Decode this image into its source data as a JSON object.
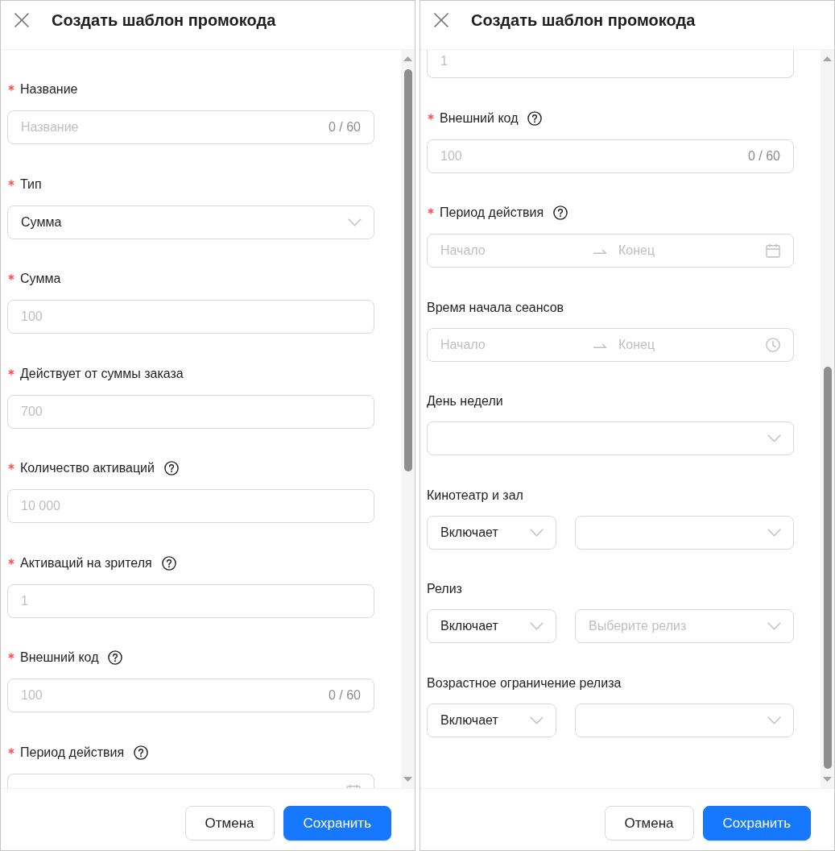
{
  "panels": [
    {
      "title": "Создать шаблон промокода",
      "scrolled": false,
      "fields": [
        {
          "kind": "text",
          "label": "Название",
          "required": true,
          "help": false,
          "placeholder": "Название",
          "counter": "0 / 60"
        },
        {
          "kind": "select",
          "label": "Тип",
          "required": true,
          "help": false,
          "value": "Сумма"
        },
        {
          "kind": "text",
          "label": "Сумма",
          "required": true,
          "help": false,
          "placeholder": "100"
        },
        {
          "kind": "text",
          "label": "Действует от суммы заказа",
          "required": true,
          "help": false,
          "placeholder": "700"
        },
        {
          "kind": "text",
          "label": "Количество активаций",
          "required": true,
          "help": true,
          "placeholder": "10 000"
        },
        {
          "kind": "text",
          "label": "Активаций на зрителя",
          "required": true,
          "help": true,
          "placeholder": "1"
        },
        {
          "kind": "text",
          "label": "Внешний код",
          "required": true,
          "help": true,
          "placeholder": "100",
          "counter": "0 / 60"
        },
        {
          "kind": "date-range-head",
          "label": "Период действия",
          "required": true,
          "help": true
        }
      ],
      "buttons": [
        {
          "label": "Отмена",
          "primary": false
        },
        {
          "label": "Сохранить",
          "primary": true
        }
      ]
    },
    {
      "title": "Создать шаблон промокода",
      "scrolled": true,
      "fields": [
        {
          "kind": "text-tail",
          "placeholder": "1"
        },
        {
          "kind": "text",
          "label": "Внешний код",
          "required": true,
          "help": true,
          "placeholder": "100",
          "counter": "0 / 60"
        },
        {
          "kind": "date-range",
          "label": "Период действия",
          "required": true,
          "help": true,
          "start_placeholder": "Начало",
          "end_placeholder": "Конец"
        },
        {
          "kind": "time-range",
          "label": "Время начала сеансов",
          "required": false,
          "help": false,
          "start_placeholder": "Начало",
          "end_placeholder": "Конец"
        },
        {
          "kind": "select",
          "label": "День недели",
          "required": false,
          "help": false
        },
        {
          "kind": "pair",
          "label": "Кинотеатр и зал",
          "required": false,
          "help": false,
          "operator": "Включает"
        },
        {
          "kind": "pair",
          "label": "Релиз",
          "required": false,
          "help": false,
          "operator": "Включает",
          "placeholder": "Выберите релиз"
        },
        {
          "kind": "pair",
          "label": "Возрастное ограничение релиза",
          "required": false,
          "help": false,
          "operator": "Включает"
        }
      ],
      "buttons": [
        {
          "label": "Отмена",
          "primary": false
        },
        {
          "label": "Сохранить",
          "primary": true
        }
      ]
    }
  ]
}
